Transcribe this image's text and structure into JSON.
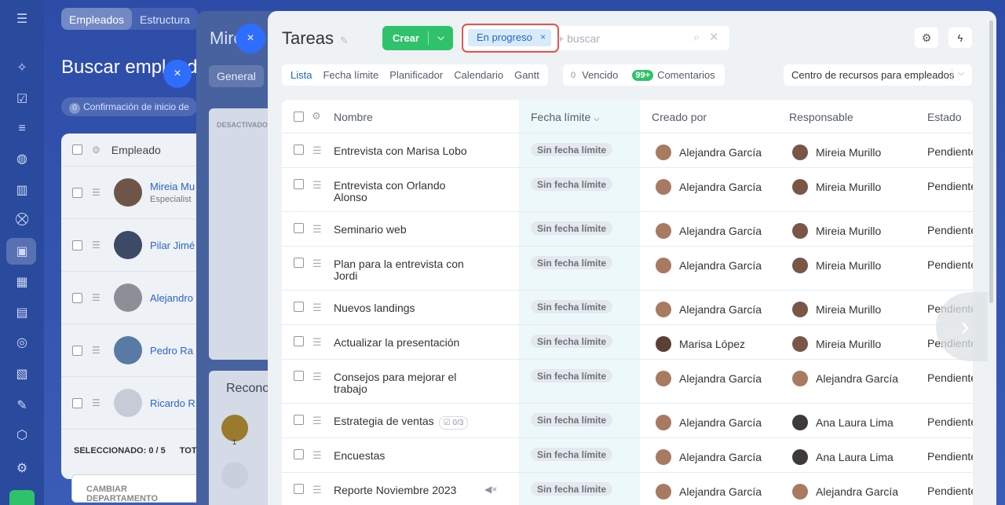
{
  "rail": {
    "icons": [
      "menu-icon",
      "puzzle-icon",
      "checkbox-icon",
      "filter-icon",
      "robot-icon",
      "chart-icon",
      "cart-icon",
      "id-card-icon",
      "calendar-icon",
      "building-icon",
      "target-icon",
      "document-icon",
      "pen-icon",
      "box-icon",
      "settings-icon",
      "rocket-icon"
    ]
  },
  "employees": {
    "tabs": [
      "Empleados",
      "Estructura"
    ],
    "title": "Buscar empleados",
    "close": "×",
    "onboarding": {
      "count": "0",
      "label": "Confirmación de inicio de"
    },
    "header": "Empleado",
    "rows": [
      {
        "name": "Mireia Mu",
        "subtitle": "Especialist"
      },
      {
        "name": "Pilar Jimé",
        "subtitle": ""
      },
      {
        "name": "Alejandro",
        "subtitle": ""
      },
      {
        "name": "Pedro Ra",
        "subtitle": ""
      },
      {
        "name": "Ricardo R",
        "subtitle": ""
      }
    ],
    "selected": "SELECCIONADO: 0 / 5",
    "total": "TOT",
    "change_dept": "CAMBIAR DEPARTAMENTO"
  },
  "profile": {
    "name": "Mire",
    "close": "×",
    "tab_general": "General",
    "status_tag": "DESACTIVADO",
    "recognition": "Recono",
    "trophy_count": "1"
  },
  "tasks": {
    "title": "Tareas",
    "create_label": "Crear",
    "filter_chip": "En progreso",
    "filter_clear": "×",
    "search_placeholder": "+ buscar",
    "views": [
      "Lista",
      "Fecha límite",
      "Planificador",
      "Calendario",
      "Gantt"
    ],
    "selected_view": "Lista",
    "counters": {
      "overdue_count": "0",
      "overdue_label": "Vencido",
      "comments_count": "99+",
      "comments_label": "Comentarios"
    },
    "resource_center": "Centro de recursos para empleados",
    "columns": {
      "name": "Nombre",
      "deadline": "Fecha límite",
      "created_by": "Creado por",
      "responsible": "Responsable",
      "status": "Estado"
    },
    "no_deadline": "Sin fecha límite",
    "rows": [
      {
        "name": "Entrevista con Marisa Lobo",
        "created_by": "Alejandra García",
        "responsible": "Mireia Murillo",
        "status": "Pendiente"
      },
      {
        "name": "Entrevista con Orlando Alonso",
        "created_by": "Alejandra García",
        "responsible": "Mireia Murillo",
        "status": "Pendiente"
      },
      {
        "name": "Seminario web",
        "created_by": "Alejandra García",
        "responsible": "Mireia Murillo",
        "status": "Pendiente"
      },
      {
        "name": "Plan para la entrevista con Jordi",
        "created_by": "Alejandra García",
        "responsible": "Mireia Murillo",
        "status": "Pendiente"
      },
      {
        "name": "Nuevos landings",
        "created_by": "Alejandra García",
        "responsible": "Mireia Murillo",
        "status": "Pendiente"
      },
      {
        "name": "Actualizar la presentación",
        "created_by": "Marisa López",
        "responsible": "Mireia Murillo",
        "status": "Pendiente"
      },
      {
        "name": "Consejos para mejorar el trabajo",
        "created_by": "Alejandra García",
        "responsible": "Alejandra García",
        "status": "Pendiente"
      },
      {
        "name": "Estrategia de ventas",
        "checklist": "0/3",
        "created_by": "Alejandra García",
        "responsible": "Ana Laura Lima",
        "status": "Pendiente"
      },
      {
        "name": "Encuestas",
        "created_by": "Alejandra García",
        "responsible": "Ana Laura Lima",
        "status": "Pendiente"
      },
      {
        "name": "Reporte Noviembre 2023",
        "muted": true,
        "created_by": "Alejandra García",
        "responsible": "Alejandra García",
        "status": "Pendiente"
      }
    ]
  }
}
